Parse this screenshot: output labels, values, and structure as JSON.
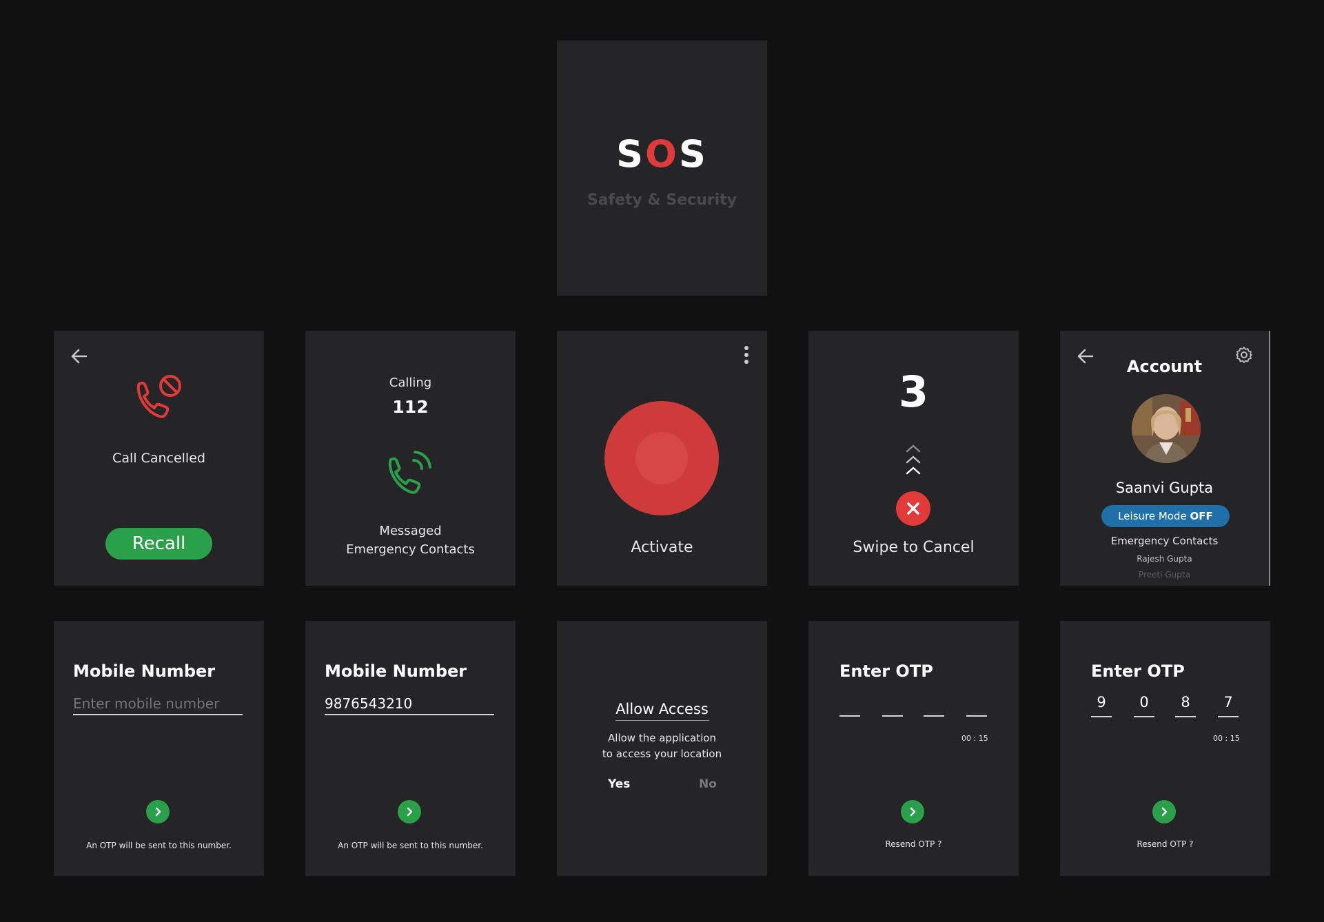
{
  "splash": {
    "logo_s1": "S",
    "logo_o": "O",
    "logo_s2": "S",
    "tagline": "Safety & Security"
  },
  "call_cancelled": {
    "status": "Call Cancelled",
    "recall_label": "Recall",
    "icon": "phone-blocked-icon"
  },
  "calling": {
    "label": "Calling",
    "number": "112",
    "message_line1": "Messaged",
    "message_line2": "Emergency Contacts",
    "icon": "phone-ringing-icon"
  },
  "activate": {
    "label": "Activate",
    "icon": "more-vertical-icon"
  },
  "countdown": {
    "value": "3",
    "label": "Swipe to Cancel"
  },
  "account": {
    "title": "Account",
    "name": "Saanvi Gupta",
    "leisure_mode_label": "Leisure Mode ",
    "leisure_mode_state": "OFF",
    "contacts_heading": "Emergency Contacts",
    "contacts": [
      "Rajesh Gupta",
      "Preeti Gupta"
    ]
  },
  "mobile_empty": {
    "title": "Mobile Number",
    "placeholder": "Enter mobile number",
    "note": "An OTP will be sent to this number."
  },
  "mobile_filled": {
    "title": "Mobile Number",
    "value": "9876543210",
    "note": "An OTP will be sent to this number."
  },
  "allow_access": {
    "title": "Allow Access",
    "line1": "Allow the application",
    "line2": "to access your location",
    "yes": "Yes",
    "no": "No"
  },
  "otp_empty": {
    "title": "Enter OTP",
    "timer": "00 : 15",
    "resend": "Resend OTP ?"
  },
  "otp_filled": {
    "title": "Enter OTP",
    "digits": [
      "9",
      "0",
      "8",
      "7"
    ],
    "timer": "00 : 15",
    "resend": "Resend OTP ?"
  },
  "colors": {
    "background": "#111112",
    "card": "#252527",
    "accent_red": "#e03a3a",
    "accent_green": "#2aa04a",
    "leisure_blue": "#1f6fa8"
  }
}
